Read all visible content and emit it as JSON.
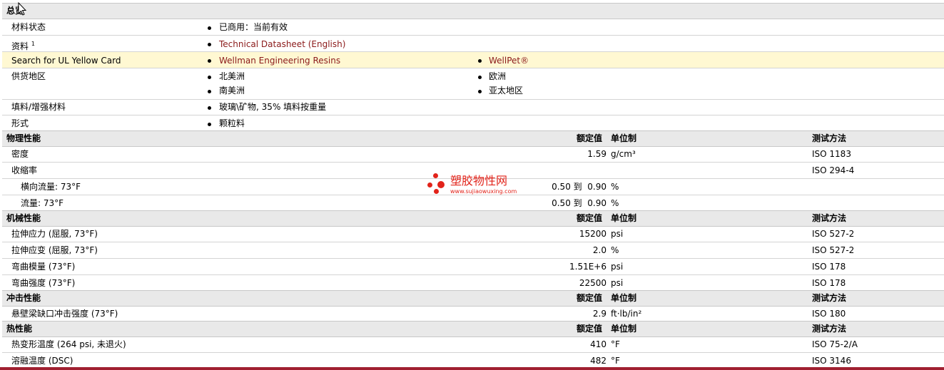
{
  "general": {
    "title": "总览",
    "material_status_label": "材料状态",
    "material_status_value": "已商用：当前有效",
    "docs_label": "资料",
    "docs_sup": "1",
    "docs_link": "Technical Datasheet (English)",
    "ul_label": "Search for UL Yellow Card",
    "ul_link1": "Wellman Engineering Resins",
    "ul_link2": "WellPet®",
    "region_label": "供货地区",
    "regions": [
      "北美洲",
      "欧洲",
      "南美洲",
      "亚太地区"
    ],
    "filler_label": "填料/增强材料",
    "filler_value": "玻璃\\矿物, 35% 填料按重量",
    "form_label": "形式",
    "form_value": "颗粒料"
  },
  "columns": {
    "nominal": "额定值",
    "unit": "单位制",
    "method": "测试方法"
  },
  "physical": {
    "title": "物理性能",
    "rows": [
      {
        "name": "密度",
        "value": "1.59",
        "unit": "g/cm³",
        "method": "ISO 1183"
      },
      {
        "name": "收缩率",
        "value": "",
        "unit": "",
        "method": "ISO 294-4"
      },
      {
        "name": "横向流量: 73°F",
        "value": "0.50 到  0.90",
        "unit": "%",
        "method": ""
      },
      {
        "name": "流量: 73°F",
        "value": "0.50 到  0.90",
        "unit": "%",
        "method": ""
      }
    ]
  },
  "mechanical": {
    "title": "机械性能",
    "rows": [
      {
        "name": "拉伸应力 (屈服, 73°F)",
        "value": "15200",
        "unit": "psi",
        "method": "ISO 527-2"
      },
      {
        "name": "拉伸应变 (屈服, 73°F)",
        "value": "2.0",
        "unit": "%",
        "method": "ISO 527-2"
      },
      {
        "name": "弯曲模量 (73°F)",
        "value": "1.51E+6",
        "unit": "psi",
        "method": "ISO 178"
      },
      {
        "name": "弯曲强度 (73°F)",
        "value": "22500",
        "unit": "psi",
        "method": "ISO 178"
      }
    ]
  },
  "impact": {
    "title": "冲击性能",
    "rows": [
      {
        "name": "悬壁梁缺口冲击强度 (73°F)",
        "value": "2.9",
        "unit": "ft·lb/in²",
        "method": "ISO 180"
      }
    ]
  },
  "thermal": {
    "title": "热性能",
    "rows": [
      {
        "name": "热变形温度 (264 psi, 未退火)",
        "value": "410",
        "unit": "°F",
        "method": "ISO 75-2/A"
      },
      {
        "name": "溶融温度 (DSC)",
        "value": "482",
        "unit": "°F",
        "method": "ISO 3146"
      }
    ]
  },
  "watermark": {
    "name": "塑胶物性网",
    "url": "www.sujiaowuxing.com",
    "color": "#e2231a"
  }
}
